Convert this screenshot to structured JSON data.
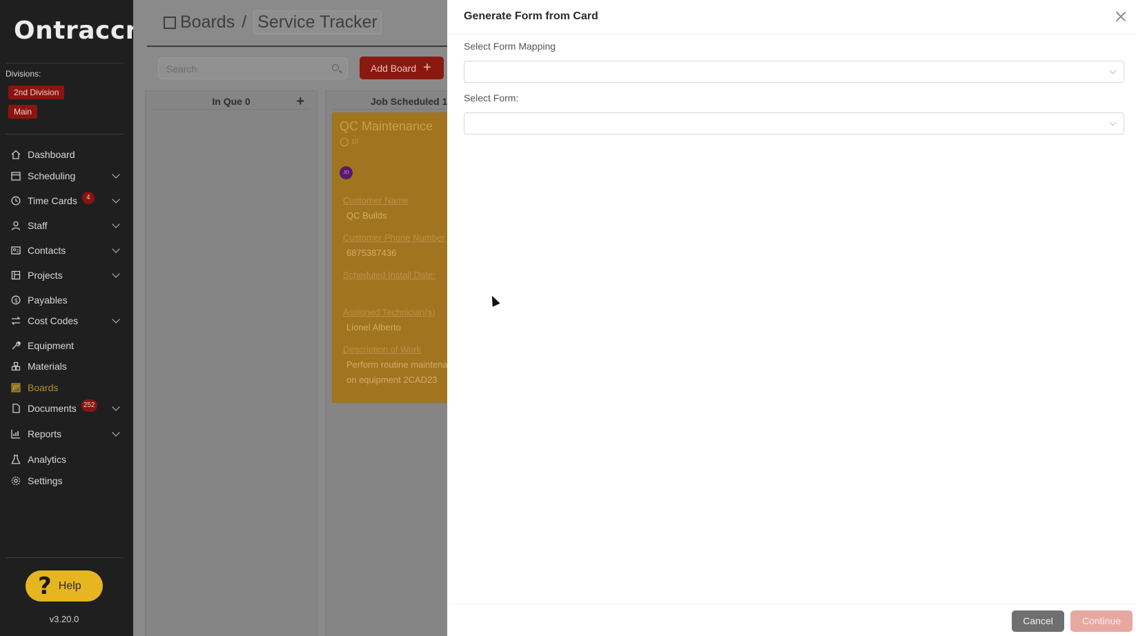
{
  "app": {
    "logo_text": "Ontraccr",
    "version": "v3.20.0",
    "help_label": "Help"
  },
  "divisions": {
    "label": "Divisions:",
    "tags": [
      "2nd Division",
      "Main"
    ]
  },
  "nav": [
    {
      "label": "Dashboard",
      "icon": "home-icon",
      "chevron": false,
      "badge": ""
    },
    {
      "label": "Scheduling",
      "icon": "calendar-icon",
      "chevron": true,
      "badge": ""
    },
    {
      "label": "Time Cards",
      "icon": "clock-icon",
      "chevron": true,
      "badge": "4"
    },
    {
      "label": "Staff",
      "icon": "user-icon",
      "chevron": true,
      "badge": ""
    },
    {
      "label": "Contacts",
      "icon": "contacts-icon",
      "chevron": true,
      "badge": ""
    },
    {
      "label": "Projects",
      "icon": "project-icon",
      "chevron": true,
      "badge": ""
    },
    {
      "label": "Payables",
      "icon": "dollar-icon",
      "chevron": false,
      "badge": ""
    },
    {
      "label": "Cost Codes",
      "icon": "swap-icon",
      "chevron": true,
      "badge": ""
    },
    {
      "label": "Equipment",
      "icon": "tool-icon",
      "chevron": false,
      "badge": ""
    },
    {
      "label": "Materials",
      "icon": "materials-icon",
      "chevron": false,
      "badge": ""
    },
    {
      "label": "Boards",
      "icon": "board-icon",
      "chevron": false,
      "badge": "",
      "active": true
    },
    {
      "label": "Documents",
      "icon": "document-icon",
      "chevron": true,
      "badge": "252"
    },
    {
      "label": "Reports",
      "icon": "chart-icon",
      "chevron": true,
      "badge": ""
    },
    {
      "label": "Analytics",
      "icon": "flask-icon",
      "chevron": false,
      "badge": ""
    },
    {
      "label": "Settings",
      "icon": "gear-icon",
      "chevron": false,
      "badge": ""
    }
  ],
  "main": {
    "breadcrumb_root": "Boards",
    "breadcrumb_sep": "/",
    "breadcrumb_current": "Service Tracker",
    "search_placeholder": "Search",
    "add_board_label": "Add Board",
    "columns": [
      {
        "title": "In Que 0"
      },
      {
        "title": "Job Scheduled 1"
      }
    ],
    "card": {
      "title": "QC Maintenance",
      "count": "10",
      "avatar": "JD",
      "fields": [
        {
          "label": "Customer Name",
          "value": "QC Builds"
        },
        {
          "label": "Customer Phone Number",
          "value": "6875387436"
        },
        {
          "label": "Scheduled Install Date:",
          "value": ""
        },
        {
          "label": "Assigned Technician(s)",
          "value": "Lionel Alberto"
        },
        {
          "label": "Description of Work",
          "value": "Perform routine maintenance",
          "value2": "on equipment 2CAD23"
        }
      ]
    }
  },
  "dialog": {
    "title": "Generate Form from Card",
    "mapping_label": "Select Form Mapping",
    "form_label": "Select Form:",
    "cancel_label": "Cancel",
    "continue_label": "Continue"
  }
}
